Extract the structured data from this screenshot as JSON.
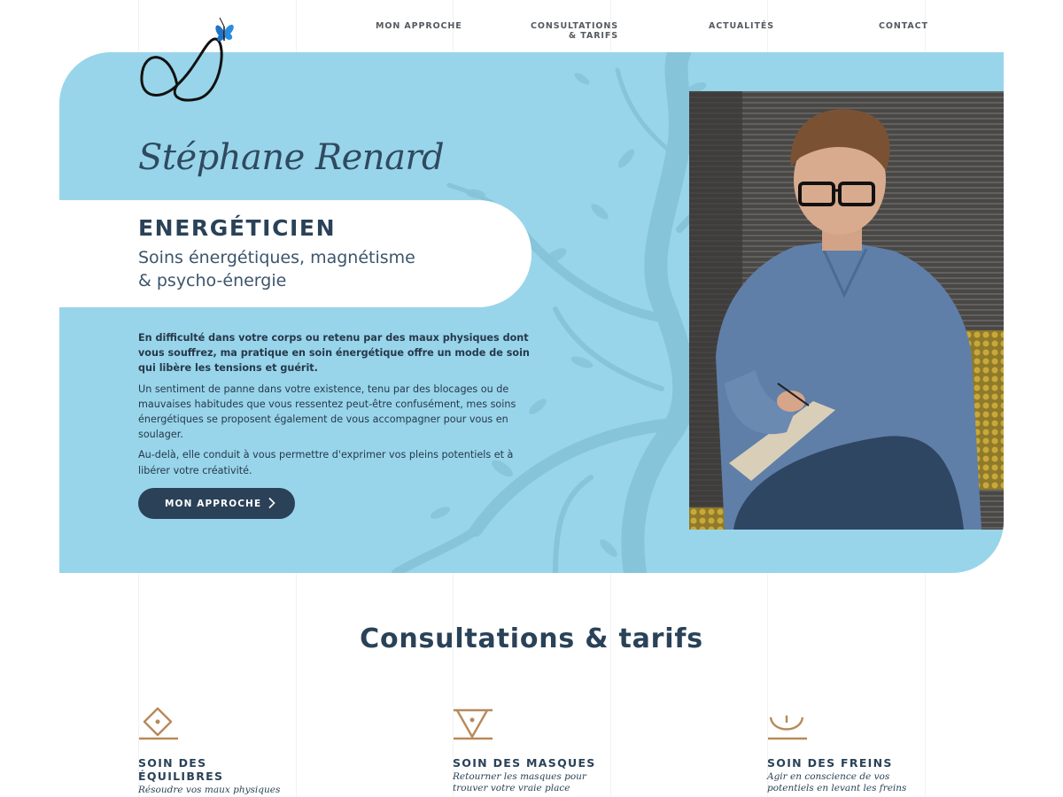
{
  "header": {
    "nav": [
      {
        "label": "MON APPROCHE"
      },
      {
        "label_line1": "CONSULTATIONS",
        "label_line2": "& TARIFS"
      },
      {
        "label": "ACTUALITÉS"
      },
      {
        "label": "CONTACT"
      }
    ],
    "logo_icon": "infinity-butterfly-logo"
  },
  "hero": {
    "name": "Stéphane Renard",
    "title": "ENERGÉTICIEN",
    "subtitle_line1": "Soins énergétiques, magnétisme",
    "subtitle_line2": "& psycho-énergie",
    "paragraph_lead": "En difficulté dans votre corps ou retenu par des maux physiques dont vous souffrez, ma pratique en soin énergétique offre un mode de soin qui libère les tensions et guérit.",
    "paragraph_2": "Un sentiment de panne dans votre existence, tenu par des blocages ou de mauvaises habitudes que vous ressentez peut-être confusément, mes soins énergétiques se proposent également de vous accompagner pour vous en soulager.",
    "paragraph_3": "Au-delà, elle conduit à vous permettre d'exprimer vos pleins potentiels et à libérer votre créativité.",
    "cta_label": "MON APPROCHE",
    "cta_icon": "chevron-right-icon",
    "photo": "man-with-glasses-writing-notebook"
  },
  "consultations": {
    "title": "Consultations & tarifs",
    "cards": [
      {
        "icon": "diamond-circle-icon",
        "title_line1": "SOIN DES",
        "title_line2": "ÉQUILIBRES",
        "desc": "Résoudre vos maux physiques"
      },
      {
        "icon": "triangle-mask-icon",
        "title_line1": "SOIN DES MASQUES",
        "title_line2": "",
        "desc": "Retourner les masques pour trouver votre vraie place"
      },
      {
        "icon": "bowl-brake-icon",
        "title_line1": "SOIN DES FREINS",
        "title_line2": "",
        "desc": "Agir en conscience de vos potentiels en levant les freins"
      }
    ]
  },
  "colors": {
    "hero_bg": "#98d5ea",
    "navy": "#2a4158",
    "accent_copper": "#b8895a",
    "butterfly_blue": "#1f74c8"
  }
}
